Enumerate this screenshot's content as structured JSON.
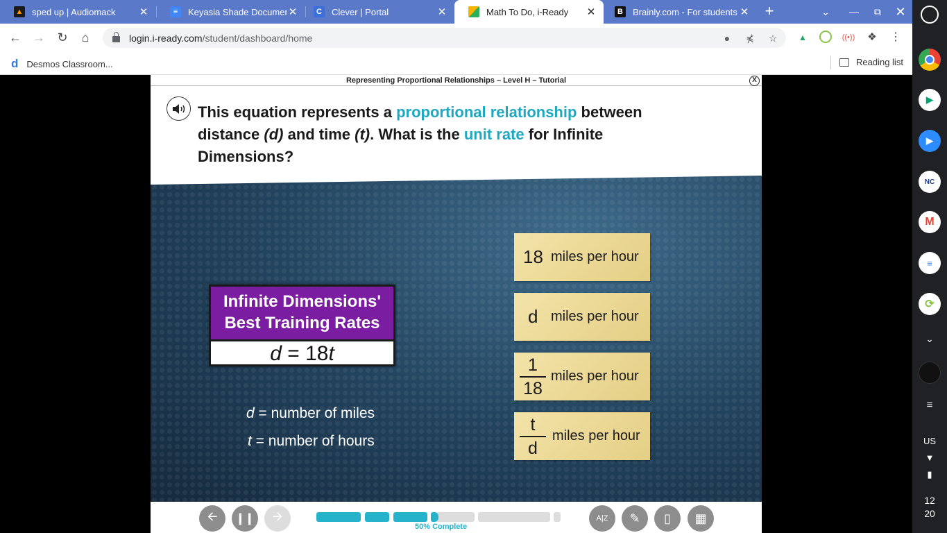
{
  "browser": {
    "tabs": [
      {
        "title": "sped up | Audiomack",
        "icon": "audiomack-icon",
        "active": false
      },
      {
        "title": "Keyasia Shade Document",
        "icon": "docs-icon",
        "active": false
      },
      {
        "title": "Clever | Portal",
        "icon": "clever-icon",
        "active": false
      },
      {
        "title": "Math To Do, i-Ready",
        "icon": "iready-icon",
        "active": true
      },
      {
        "title": "Brainly.com - For students",
        "icon": "brainly-icon",
        "active": false
      }
    ],
    "url_host": "login.i-ready.com",
    "url_path": "/student/dashboard/home",
    "bookmark": "Desmos Classroom...",
    "reading_list": "Reading list"
  },
  "lesson": {
    "title": "Representing Proportional Relationships – Level H – Tutorial",
    "close": "X",
    "question": {
      "p1": "This equation represents a ",
      "hl1": "proportional relationship",
      "p2": " between distance ",
      "v1": "(d)",
      "p3": " and time ",
      "v2": "(t)",
      "p4": ". What is the ",
      "hl2": "unit rate",
      "p5": " for Infinite Dimensions?"
    },
    "rates_box": {
      "heading_line1": "Infinite Dimensions'",
      "heading_line2": "Best Training Rates",
      "eq_var": "d",
      "eq_rest": " = 18",
      "eq_var2": "t"
    },
    "definitions": [
      {
        "var": "d",
        "text": " = number of miles"
      },
      {
        "var": "t",
        "text": " = number of hours"
      }
    ],
    "answers": [
      {
        "value": "18",
        "unit": "miles per hour"
      },
      {
        "value": "d",
        "unit": "miles per hour"
      },
      {
        "num": "1",
        "den": "18",
        "unit": "miles per hour"
      },
      {
        "num": "t",
        "den": "d",
        "unit": "miles per hour"
      }
    ],
    "progress_label": "50% Complete",
    "progress": 0.5
  },
  "system": {
    "locale": "US",
    "clock_h": "12",
    "clock_m": "20"
  }
}
